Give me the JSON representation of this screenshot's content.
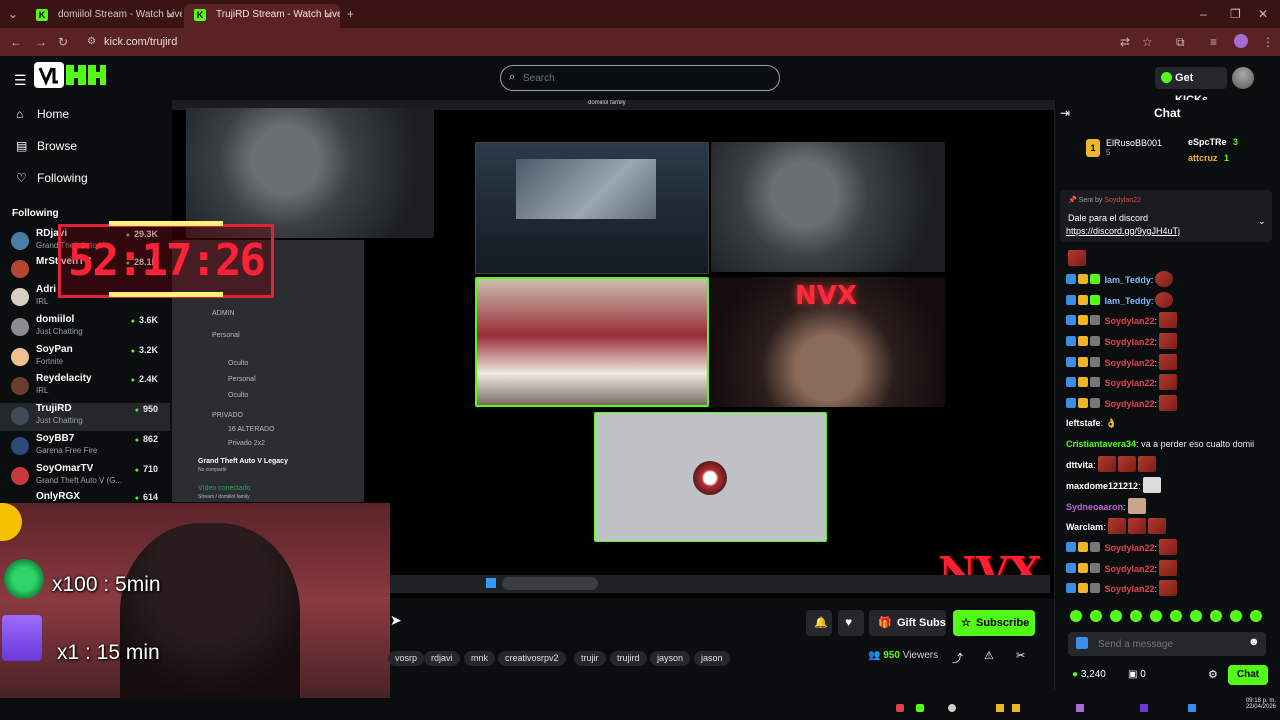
{
  "browser": {
    "tabs": [
      {
        "title": "domiilol Stream - Watch Live o"
      },
      {
        "title": "TrujiRD Stream - Watch Live"
      }
    ],
    "url": "kick.com/trujird"
  },
  "header": {
    "search_placeholder": "Search",
    "get_kicks_label": "Get KICKs"
  },
  "nav": {
    "items": [
      {
        "label": "Home",
        "icon": "home-icon"
      },
      {
        "label": "Browse",
        "icon": "compass-icon"
      },
      {
        "label": "Following",
        "icon": "heart-icon"
      }
    ],
    "following_heading": "Following"
  },
  "following": [
    {
      "name": "RDjavi",
      "sub": "Grand Theft Auto V",
      "viewers": "29.3K"
    },
    {
      "name": "MrStivenTC",
      "sub": "",
      "viewers": "28.1K"
    },
    {
      "name": "Adri",
      "sub": "IRL",
      "viewers": ""
    },
    {
      "name": "domiilol",
      "sub": "Just Chatting",
      "viewers": "3.6K"
    },
    {
      "name": "SoyPan",
      "sub": "Fortnite",
      "viewers": "3.2K"
    },
    {
      "name": "Reydelacity",
      "sub": "IRL",
      "viewers": "2.4K"
    },
    {
      "name": "TrujiRD",
      "sub": "Just Chatting",
      "viewers": "950"
    },
    {
      "name": "SoyBB7",
      "sub": "Garena Free Fire",
      "viewers": "862"
    },
    {
      "name": "SoyOmarTV",
      "sub": "Grand Theft Auto V (G...",
      "viewers": "710"
    },
    {
      "name": "OnlyRGX",
      "sub": "",
      "viewers": "614"
    }
  ],
  "overlay": {
    "timer": "52:17:26",
    "reward1": "x100 : 5min",
    "reward2": "x1 : 15 min",
    "brand": "NVX",
    "call_title": "domiilol family"
  },
  "discord": {
    "sections": [
      "ADMIN",
      "Personal",
      "Oculto",
      "Personal",
      "Oculto",
      "PRIVADO",
      "16 ALTERADO",
      "Privado 2x2"
    ],
    "game": "Grand Theft Auto V Legacy",
    "game_sub": "No compartir",
    "voice_status": "Vídeo conectado",
    "voice_sub": "Stream / domiilol family"
  },
  "stream": {
    "tags": [
      "vosrp",
      "rdjavi",
      "mnk",
      "creativosrpv2",
      "trujir",
      "trujird",
      "jayson",
      "jason"
    ],
    "viewers": "950",
    "viewers_label": "Viewers",
    "gift_subs_label": "Gift Subs",
    "subscribe_label": "Subscribe"
  },
  "chat": {
    "title": "Chat",
    "top_gifters": [
      {
        "name": "ElRusoBB001",
        "count": "5"
      },
      {
        "name": "eSpcTRe",
        "count": "3"
      },
      {
        "name": "attcruz",
        "count": "1"
      }
    ],
    "pinned_sender_label": "Sent by",
    "pinned_sender": "Soydylan22",
    "pinned_text": "Dale para el discord",
    "pinned_link": "https://discord.gg/9ygJH4uTj",
    "messages": [
      {
        "user": "",
        "text": "",
        "color": "#ffffff"
      },
      {
        "user": "Iam_Teddy",
        "text": "",
        "color": "#7fb8ff"
      },
      {
        "user": "Iam_Teddy",
        "text": "",
        "color": "#7fb8ff"
      },
      {
        "user": "Soydylan22",
        "text": "",
        "color": "#e0434f"
      },
      {
        "user": "Soydylan22",
        "text": "",
        "color": "#e0434f"
      },
      {
        "user": "Soydylan22",
        "text": "",
        "color": "#e0434f"
      },
      {
        "user": "Soydylan22",
        "text": "",
        "color": "#e0434f"
      },
      {
        "user": "Soydylan22",
        "text": "",
        "color": "#e0434f"
      },
      {
        "user": "leftstafe",
        "text": "",
        "color": "#ffffff"
      },
      {
        "user": "Cristiantavera34",
        "text": "va a perder eso cualto domii",
        "color": "#53fc18"
      },
      {
        "user": "dttvita",
        "text": "",
        "color": "#ffffff"
      },
      {
        "user": "maxdome121212",
        "text": "",
        "color": "#ffffff"
      },
      {
        "user": "Sydneoaaron",
        "text": "",
        "color": "#c060e0"
      },
      {
        "user": "Warclam",
        "text": "",
        "color": "#ffffff"
      },
      {
        "user": "Soydylan22",
        "text": "",
        "color": "#e0434f"
      },
      {
        "user": "Soydylan22",
        "text": "",
        "color": "#e0434f"
      },
      {
        "user": "Soydylan22",
        "text": "",
        "color": "#e0434f"
      }
    ],
    "input_placeholder": "Send a message",
    "kicks_count": "3,240",
    "sub_count": "0",
    "chat_button": "Chat"
  },
  "system": {
    "time": "09:18 p. m.",
    "date": "22/04/2026"
  },
  "colors": {
    "accent": "#53fc18",
    "browser_frame": "#5a2222",
    "timer_red": "#ff2236"
  }
}
